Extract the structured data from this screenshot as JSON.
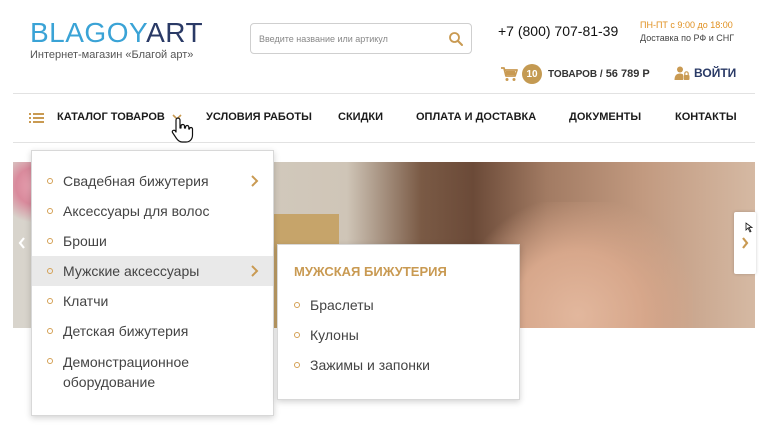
{
  "logo": {
    "part1": "BLAGOY",
    "part2": "ART",
    "tagline": "Интернет-магазин «Благой арт»"
  },
  "search": {
    "placeholder": "Введите название или артикул",
    "icon": "search-icon"
  },
  "contacts": {
    "phone": "+7 (800) 707-81-39",
    "hours": "ПН-ПТ с 9:00 до 18:00",
    "delivery": "Доставка по РФ и СНГ"
  },
  "cart": {
    "icon": "cart-icon",
    "count": "10",
    "label": "ТОВАРОВ /",
    "total": "56 789 Р"
  },
  "login": {
    "icon": "user-lock-icon",
    "label": "ВОЙТИ"
  },
  "nav": {
    "items": [
      "КАТАЛОГ ТОВАРОВ",
      "УСЛОВИЯ РАБОТЫ",
      "СКИДКИ",
      "ОПЛАТА И ДОСТАВКА",
      "ДОКУМЕНТЫ",
      "КОНТАКТЫ"
    ]
  },
  "catalog_menu": {
    "items": [
      {
        "label": "Свадебная бижутерия",
        "has_submenu": true
      },
      {
        "label": "Аксессуары для волос",
        "has_submenu": false
      },
      {
        "label": "Броши",
        "has_submenu": false
      },
      {
        "label": "Мужские аксессуары",
        "has_submenu": true,
        "active": true
      },
      {
        "label": "Клатчи",
        "has_submenu": false
      },
      {
        "label": "Детская бижутерия",
        "has_submenu": false
      },
      {
        "label": "Демонстрационное",
        "label2": "оборудование",
        "has_submenu": false
      }
    ]
  },
  "submenu": {
    "title": "МУЖСКАЯ БИЖУТЕРИЯ",
    "items": [
      "Браслеты",
      "Кулоны",
      "Зажимы и запонки"
    ]
  },
  "colors": {
    "accent_gold": "#c99a52",
    "logo_blue": "#3aa3d6",
    "logo_navy": "#2a3a66",
    "hours_orange": "#e09020"
  }
}
